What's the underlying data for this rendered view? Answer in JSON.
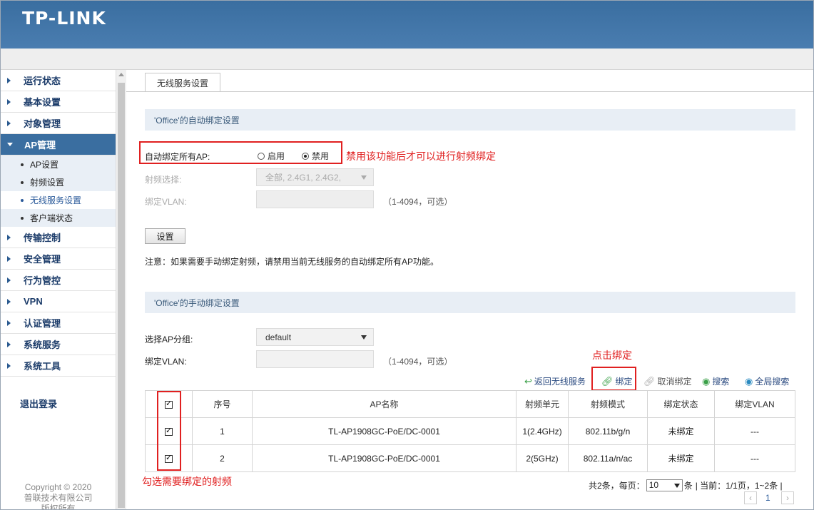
{
  "header": {
    "logo": "TP-LINK"
  },
  "sidebar": {
    "items": [
      {
        "label": "运行状态"
      },
      {
        "label": "基本设置"
      },
      {
        "label": "对象管理"
      },
      {
        "label": "AP管理"
      },
      {
        "label": "传输控制"
      },
      {
        "label": "安全管理"
      },
      {
        "label": "行为管控"
      },
      {
        "label": "VPN"
      },
      {
        "label": "认证管理"
      },
      {
        "label": "系统服务"
      },
      {
        "label": "系统工具"
      }
    ],
    "subitems": [
      {
        "label": "AP设置"
      },
      {
        "label": "射频设置"
      },
      {
        "label": "无线服务设置"
      },
      {
        "label": "客户端状态"
      }
    ],
    "logout": "退出登录",
    "copyright_line1": "Copyright © 2020",
    "copyright_line2": "普联技术有限公司",
    "copyright_line3": "版权所有"
  },
  "main": {
    "tab": "无线服务设置",
    "auto_section": {
      "title": "'Office'的自动绑定设置",
      "auto_bind_label": "自动绑定所有AP:",
      "enable_label": "启用",
      "disable_label": "禁用",
      "selected": "禁用",
      "radio_label": "射频选择:",
      "radio_value": "全部, 2.4G1, 2.4G2,",
      "vlan_label": "绑定VLAN:",
      "vlan_value": "",
      "vlan_hint": "（1-4094，可选）",
      "save_button": "设置",
      "note": "注意：如果需要手动绑定射频，请禁用当前无线服务的自动绑定所有AP功能。"
    },
    "manual_section": {
      "title": "'Office'的手动绑定设置",
      "group_label": "选择AP分组:",
      "group_value": "default",
      "vlan_label": "绑定VLAN:",
      "vlan_value": "",
      "vlan_hint": "（1-4094，可选）"
    },
    "toolbar": {
      "back": "返回无线服务",
      "bind": "绑定",
      "unbind": "取消绑定",
      "search": "搜索",
      "global_search": "全局搜索"
    },
    "table": {
      "headers": [
        "",
        "序号",
        "AP名称",
        "射频单元",
        "射频模式",
        "绑定状态",
        "绑定VLAN"
      ],
      "rows": [
        {
          "checked": true,
          "index": "1",
          "name": "TL-AP1908GC-PoE/DC-0001",
          "unit": "1(2.4GHz)",
          "mode": "802.11b/g/n",
          "status": "未绑定",
          "vlan": "---"
        },
        {
          "checked": true,
          "index": "2",
          "name": "TL-AP1908GC-PoE/DC-0001",
          "unit": "2(5GHz)",
          "mode": "802.11a/n/ac",
          "status": "未绑定",
          "vlan": "---"
        }
      ]
    },
    "pager": {
      "total": "共2条，每页：",
      "page_size": "10",
      "unit": "条",
      "current": "| 当前：1/1页，1~2条 |",
      "page": "1",
      "prev": "‹",
      "next": "›"
    },
    "annotations": {
      "disable_note": "禁用该功能后才可以进行射频绑定",
      "click_bind": "点击绑定",
      "check_radios": "勾选需要绑定的射频"
    }
  },
  "colors": {
    "header": "#3a6ea0",
    "annotation": "#e02020",
    "section_bar": "#e8eef5"
  }
}
